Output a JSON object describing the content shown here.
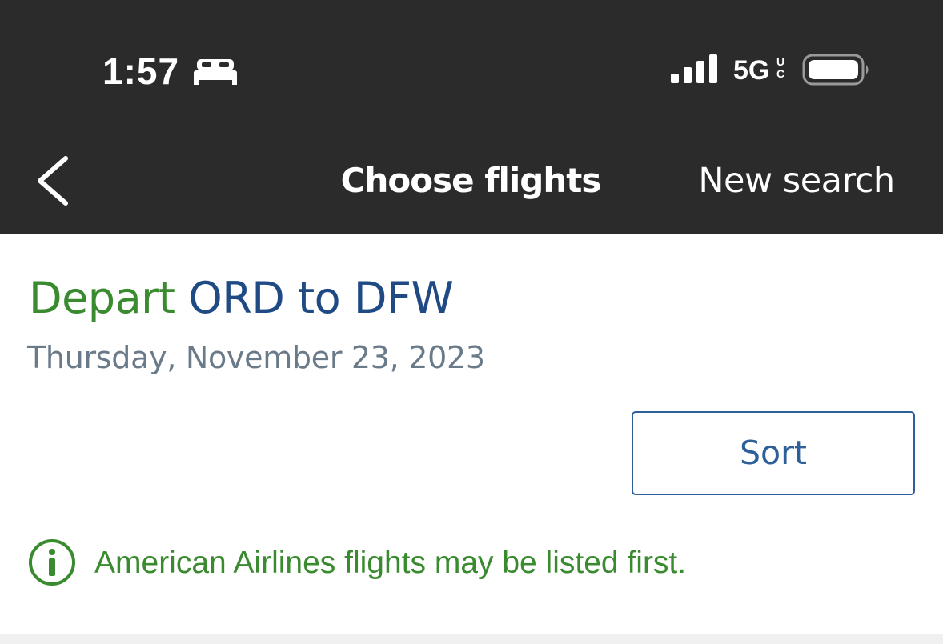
{
  "status_bar": {
    "time": "1:57",
    "network": "5G",
    "network_sub": "UC"
  },
  "nav": {
    "title": "Choose flights",
    "new_search": "New search"
  },
  "trip": {
    "depart_label": "Depart",
    "route": "ORD to DFW",
    "date": "Thursday, November 23, 2023"
  },
  "actions": {
    "sort_label": "Sort"
  },
  "notice": {
    "text": "American Airlines flights may be listed first."
  },
  "colors": {
    "header_bg": "#2b2b2b",
    "depart_green": "#3a8a2f",
    "route_blue": "#1f4a84",
    "date_gray": "#6a7a88",
    "sort_blue": "#2d5f98"
  },
  "icons": [
    "bed-icon",
    "signal-icon",
    "battery-icon",
    "back-chevron-icon",
    "info-icon"
  ]
}
